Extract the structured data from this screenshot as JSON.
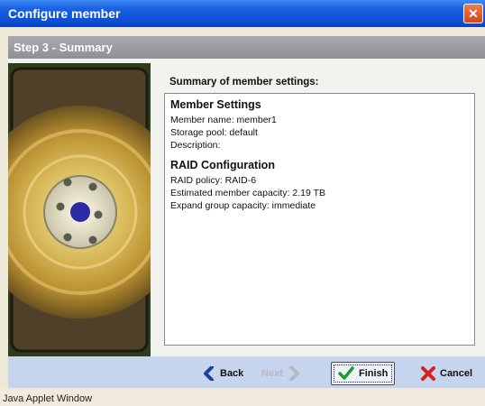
{
  "window": {
    "title": "Configure member",
    "close_glyph": "✕"
  },
  "step": {
    "title": "Step 3 - Summary"
  },
  "summary": {
    "label": "Summary of member settings:",
    "member_heading": "Member Settings",
    "member_lines": [
      "Member name:  member1",
      "Storage pool:  default",
      "Description:"
    ],
    "raid_heading": "RAID Configuration",
    "raid_lines": [
      "RAID policy:  RAID-6",
      "Estimated member capacity:  2.19 TB",
      "Expand group capacity:  immediate"
    ]
  },
  "buttons": {
    "back": "Back",
    "next": "Next",
    "finish": "Finish",
    "cancel": "Cancel"
  },
  "icons": {
    "back": "chevron-left-icon",
    "next": "chevron-right-icon",
    "finish": "checkmark-icon",
    "cancel": "x-mark-icon"
  },
  "status": {
    "text": "Java Applet Window"
  },
  "colors": {
    "titlebar": "#0a45c2",
    "stepbar": "#8e9097",
    "buttonbar": "#c6d4ed",
    "back_icon": "#1d3f9e",
    "finish_icon": "#1f9a2c",
    "cancel_icon": "#d8211a"
  }
}
